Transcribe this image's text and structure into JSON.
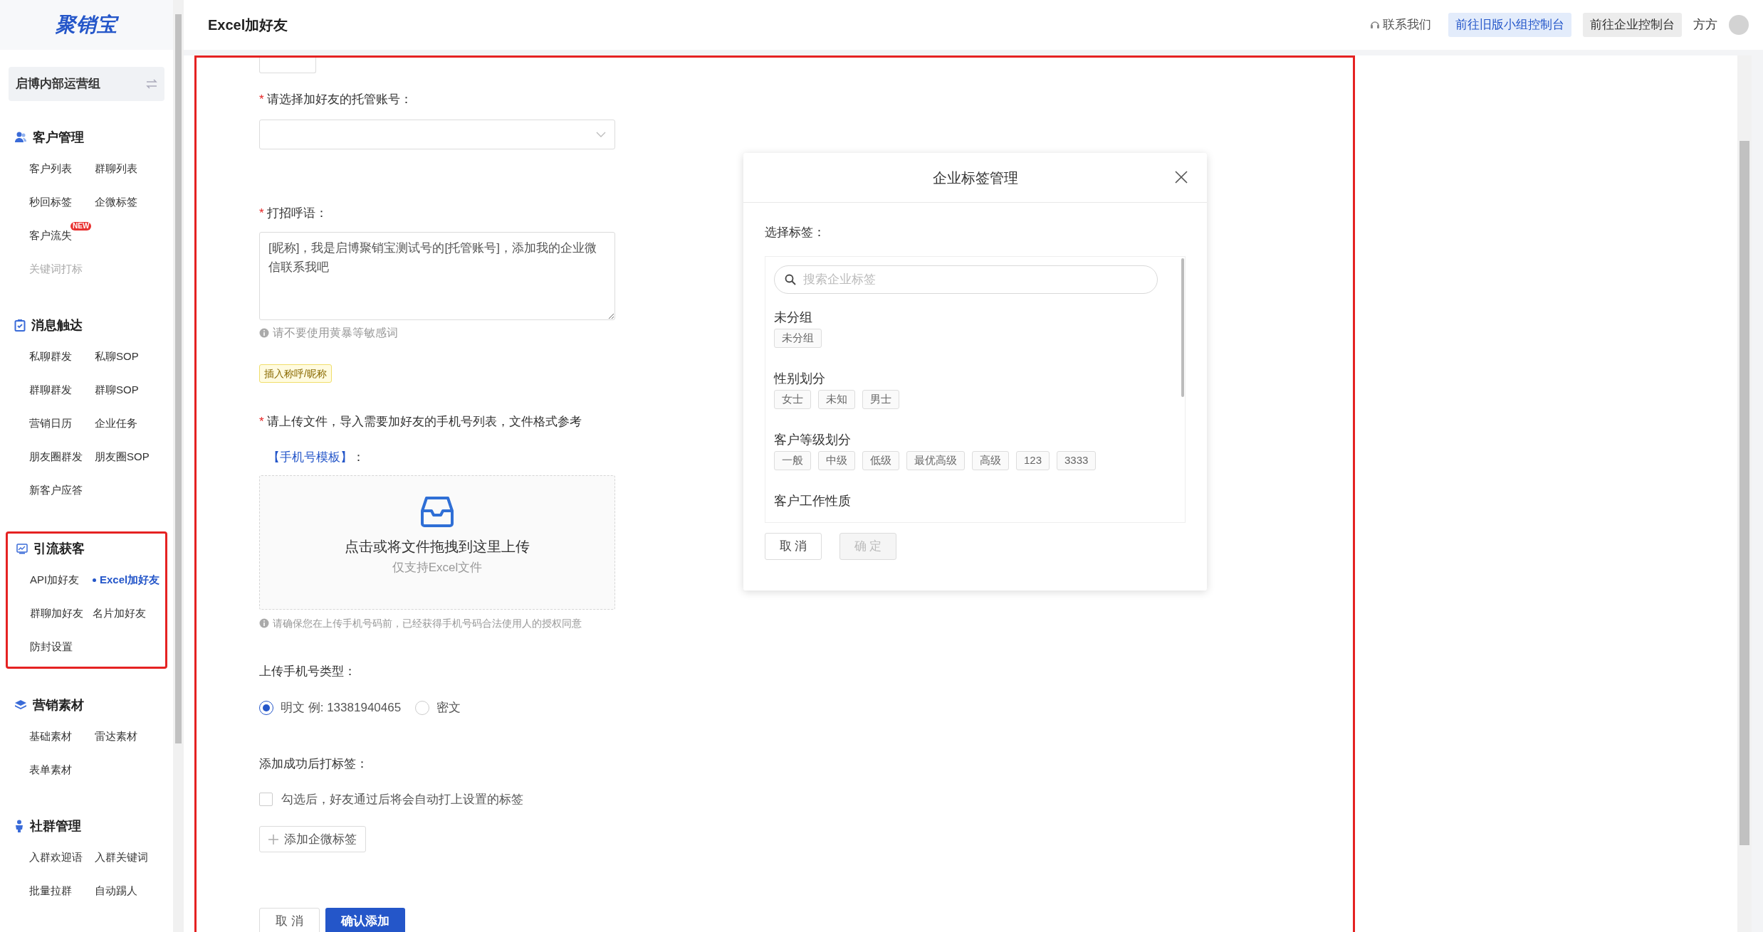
{
  "sidebar": {
    "logo": "聚销宝",
    "org": "启博内部运营组",
    "groups": [
      {
        "title": "客户管理",
        "outlined": false,
        "rows": [
          [
            {
              "label": "客户列表",
              "selected": false,
              "disabled": false
            },
            {
              "label": "群聊列表",
              "selected": false,
              "disabled": false
            }
          ],
          [
            {
              "label": "秒回标签",
              "selected": false,
              "disabled": false
            },
            {
              "label": "企微标签",
              "selected": false,
              "disabled": false
            }
          ],
          [
            {
              "label": "客户流失",
              "selected": false,
              "disabled": false,
              "badge": "NEW"
            }
          ],
          [
            {
              "label": "关键词打标",
              "selected": false,
              "disabled": true
            }
          ]
        ]
      },
      {
        "title": "消息触达",
        "outlined": false,
        "rows": [
          [
            {
              "label": "私聊群发",
              "selected": false,
              "disabled": false
            },
            {
              "label": "私聊SOP",
              "selected": false,
              "disabled": false
            }
          ],
          [
            {
              "label": "群聊群发",
              "selected": false,
              "disabled": false
            },
            {
              "label": "群聊SOP",
              "selected": false,
              "disabled": false
            }
          ],
          [
            {
              "label": "营销日历",
              "selected": false,
              "disabled": false
            },
            {
              "label": "企业任务",
              "selected": false,
              "disabled": false
            }
          ],
          [
            {
              "label": "朋友圈群发",
              "selected": false,
              "disabled": false
            },
            {
              "label": "朋友圈SOP",
              "selected": false,
              "disabled": false
            }
          ],
          [
            {
              "label": "新客户应答",
              "selected": false,
              "disabled": false
            }
          ]
        ]
      },
      {
        "title": "引流获客",
        "outlined": true,
        "rows": [
          [
            {
              "label": "API加好友",
              "selected": false,
              "disabled": false
            },
            {
              "label": "Excel加好友",
              "selected": true,
              "disabled": false
            }
          ],
          [
            {
              "label": "群聊加好友",
              "selected": false,
              "disabled": false
            },
            {
              "label": "名片加好友",
              "selected": false,
              "disabled": false
            }
          ],
          [
            {
              "label": "防封设置",
              "selected": false,
              "disabled": false
            }
          ]
        ]
      },
      {
        "title": "营销素材",
        "outlined": false,
        "rows": [
          [
            {
              "label": "基础素材",
              "selected": false,
              "disabled": false
            },
            {
              "label": "雷达素材",
              "selected": false,
              "disabled": false
            }
          ],
          [
            {
              "label": "表单素材",
              "selected": false,
              "disabled": false
            }
          ]
        ]
      },
      {
        "title": "社群管理",
        "outlined": false,
        "rows": [
          [
            {
              "label": "入群欢迎语",
              "selected": false,
              "disabled": false
            },
            {
              "label": "入群关键词",
              "selected": false,
              "disabled": false
            }
          ],
          [
            {
              "label": "批量拉群",
              "selected": false,
              "disabled": false
            },
            {
              "label": "自动踢人",
              "selected": false,
              "disabled": false
            }
          ]
        ]
      }
    ]
  },
  "header": {
    "title": "Excel加好友",
    "contact": "联系我们",
    "buttons": [
      {
        "label": "前往旧版小组控制台",
        "kind": "primary"
      },
      {
        "label": "前往企业控制台",
        "kind": "secondary"
      }
    ],
    "user": "方方"
  },
  "form": {
    "outlined": true,
    "account": {
      "label": "请选择加好友的托管账号：",
      "required_mark": "*"
    },
    "greeting": {
      "label": "打招呼语：",
      "required_mark": "*",
      "value": "[昵称]，我是启博聚销宝测试号的[托管账号]，添加我的企业微信联系我吧",
      "hint": "请不要使用黄暴等敏感词",
      "insert_button": "插入称呼/昵称"
    },
    "upload": {
      "label": "请上传文件，导入需要加好友的手机号列表，文件格式参考",
      "required_mark": "*",
      "template_link": "【手机号模板】",
      "link_suffix": "：",
      "drop_title": "点击或将文件拖拽到这里上传",
      "drop_subtitle": "仅支持Excel文件",
      "notice": "请确保您在上传手机号码前，已经获得手机号码合法使用人的授权同意"
    },
    "phone_type": {
      "label": "上传手机号类型：",
      "options": [
        {
          "label": "明文 例: 13381940465",
          "selected": true
        },
        {
          "label": "密文",
          "selected": false
        }
      ]
    },
    "tagging": {
      "label": "添加成功后打标签：",
      "checkbox": {
        "label": "勾选后，好友通过后将会自动打上设置的标签",
        "checked": false
      },
      "add_button": "添加企微标签"
    },
    "actions": {
      "cancel": "取 消",
      "submit": "确认添加"
    }
  },
  "modal": {
    "title": "企业标签管理",
    "label": "选择标签：",
    "search": {
      "placeholder": "搜索企业标签"
    },
    "groups": [
      {
        "name": "未分组",
        "tags": [
          "未分组"
        ]
      },
      {
        "name": "性别划分",
        "tags": [
          "女士",
          "未知",
          "男士"
        ]
      },
      {
        "name": "客户等级划分",
        "tags": [
          "一般",
          "中级",
          "低级",
          "最优高级",
          "高级",
          "123",
          "3333"
        ]
      },
      {
        "name": "客户工作性质"
      }
    ],
    "buttons": [
      {
        "label": "取 消",
        "disabled": false
      },
      {
        "label": "确 定",
        "disabled": true
      }
    ]
  }
}
